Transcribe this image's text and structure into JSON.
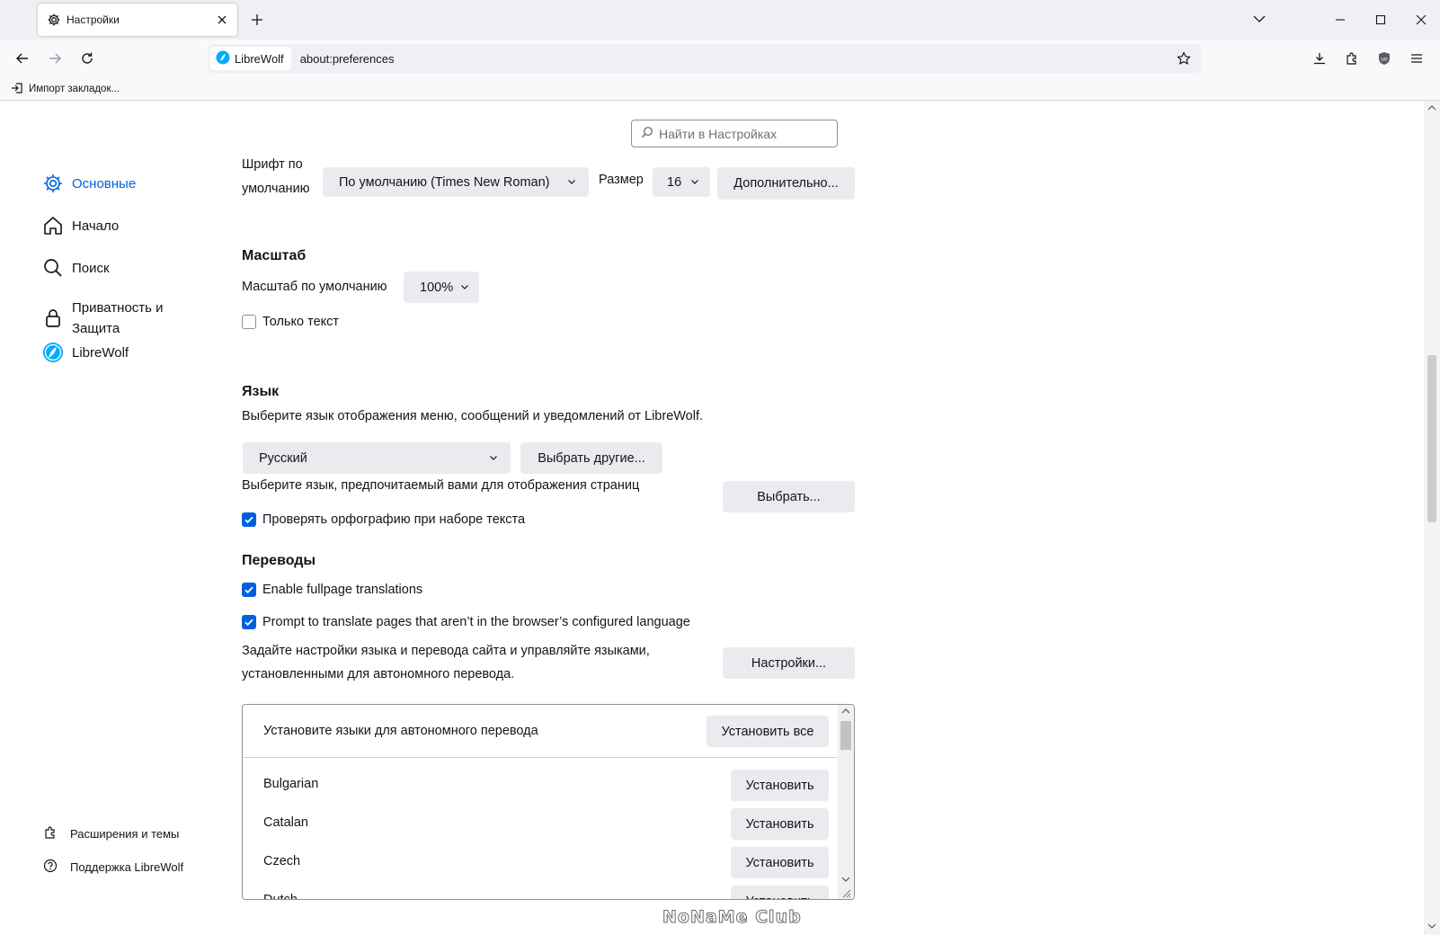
{
  "window": {
    "tab_title": "Настройки",
    "tab_icon": "gear-icon"
  },
  "navbar": {
    "identity_label": "LibreWolf",
    "url": "about:preferences"
  },
  "bookmarks": {
    "import_label": "Импорт закладок..."
  },
  "search": {
    "placeholder": "Найти в Настройках"
  },
  "sidebar": {
    "items": [
      {
        "label": "Основные",
        "icon": "gear-icon",
        "active": true
      },
      {
        "label": "Начало",
        "icon": "home-icon"
      },
      {
        "label": "Поиск",
        "icon": "search-icon"
      },
      {
        "label": "Приватность и",
        "label2": "Защита",
        "icon": "lock-icon"
      },
      {
        "label": "LibreWolf",
        "icon": "librewolf-icon"
      }
    ],
    "footer": [
      {
        "label": "Расширения и темы",
        "icon": "puzzle-icon"
      },
      {
        "label": "Поддержка LibreWolf",
        "icon": "help-icon"
      }
    ]
  },
  "fonts": {
    "label_line1": "Шрифт по",
    "label_line2": "умолчанию",
    "font_value": "По умолчанию (Times New Roman)",
    "size_label": "Размер",
    "size_value": "16",
    "advanced_button": "Дополнительно..."
  },
  "zoom": {
    "heading": "Масштаб",
    "default_label": "Масштаб по умолчанию",
    "default_value": "100%",
    "text_only_label": "Только текст",
    "text_only_checked": false
  },
  "language": {
    "heading": "Язык",
    "description": "Выберите язык отображения меню, сообщений и уведомлений от LibreWolf.",
    "selected": "Русский",
    "choose_others_button": "Выбрать другие...",
    "page_lang_description": "Выберите язык, предпочитаемый вами для отображения страниц",
    "choose_button": "Выбрать...",
    "spellcheck_label": "Проверять орфографию при наборе текста",
    "spellcheck_checked": true
  },
  "translations": {
    "heading": "Переводы",
    "fullpage_label": "Enable fullpage translations",
    "fullpage_checked": true,
    "prompt_label": "Prompt to translate pages that aren’t in the browser’s configured language",
    "prompt_checked": true,
    "settings_description_1": "Задайте настройки языка и перевода сайта и управляйте языками,",
    "settings_description_2": "установленными для автономного перевода.",
    "settings_button": "Настройки...",
    "install_header": "Установите языки для автономного перевода",
    "install_all_button": "Установить все",
    "install_button": "Установить",
    "languages": [
      "Bulgarian",
      "Catalan",
      "Czech",
      "Dutch"
    ]
  },
  "watermark": "NoNaMe Club",
  "colors": {
    "accent": "#0061e0",
    "button_bg": "#ebebef",
    "toolbar_bg": "#f9f9fb",
    "tabbar_bg": "#f0f0f4"
  }
}
